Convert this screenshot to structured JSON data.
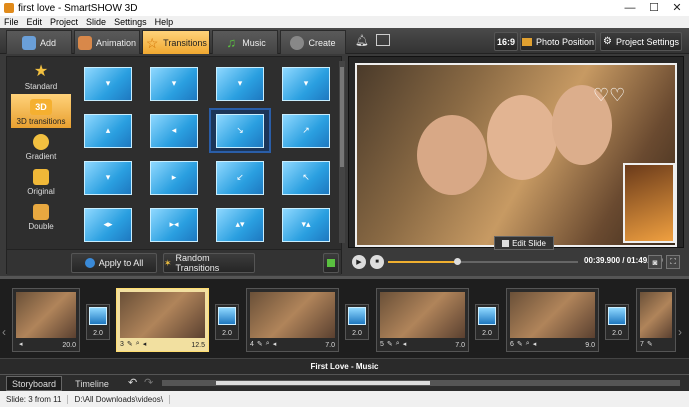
{
  "window": {
    "title": "first love - SmartSHOW 3D",
    "minimize": "—",
    "maximize": "☐",
    "close": "✕"
  },
  "menu": [
    "File",
    "Edit",
    "Project",
    "Slide",
    "Settings",
    "Help"
  ],
  "tabs": [
    {
      "label": "Add"
    },
    {
      "label": "Animation"
    },
    {
      "label": "Transitions"
    },
    {
      "label": "Music"
    },
    {
      "label": "Create"
    }
  ],
  "toolbar": {
    "aspect": "16:9",
    "photo_position": "Photo Position",
    "project_settings": "Project Settings"
  },
  "categories": [
    {
      "label": "Standard"
    },
    {
      "label": "3D transitions"
    },
    {
      "label": "Gradient"
    },
    {
      "label": "Original"
    },
    {
      "label": "Double"
    }
  ],
  "cat_badge": "3D",
  "apply_all": "Apply to All",
  "random_transitions": "Random Transitions",
  "preview": {
    "edit_slide": "Edit Slide",
    "time": "00:39.900 / 01:49.500"
  },
  "slides": [
    {
      "num": "",
      "duration": "20.0"
    },
    {
      "num": "3",
      "duration": "12.5"
    },
    {
      "num": "4",
      "duration": "7.0"
    },
    {
      "num": "5",
      "duration": "7.0"
    },
    {
      "num": "6",
      "duration": "9.0"
    },
    {
      "num": "7",
      "duration": ""
    }
  ],
  "transitions": [
    "2.0",
    "2.0",
    "2.0",
    "2.0",
    "2.0"
  ],
  "music_track": "First Love - Music",
  "bottom_tabs": {
    "storyboard": "Storyboard",
    "timeline": "Timeline"
  },
  "status": {
    "slide": "Slide: 3 from 11",
    "path": "D:\\All Downloads\\videos\\"
  }
}
